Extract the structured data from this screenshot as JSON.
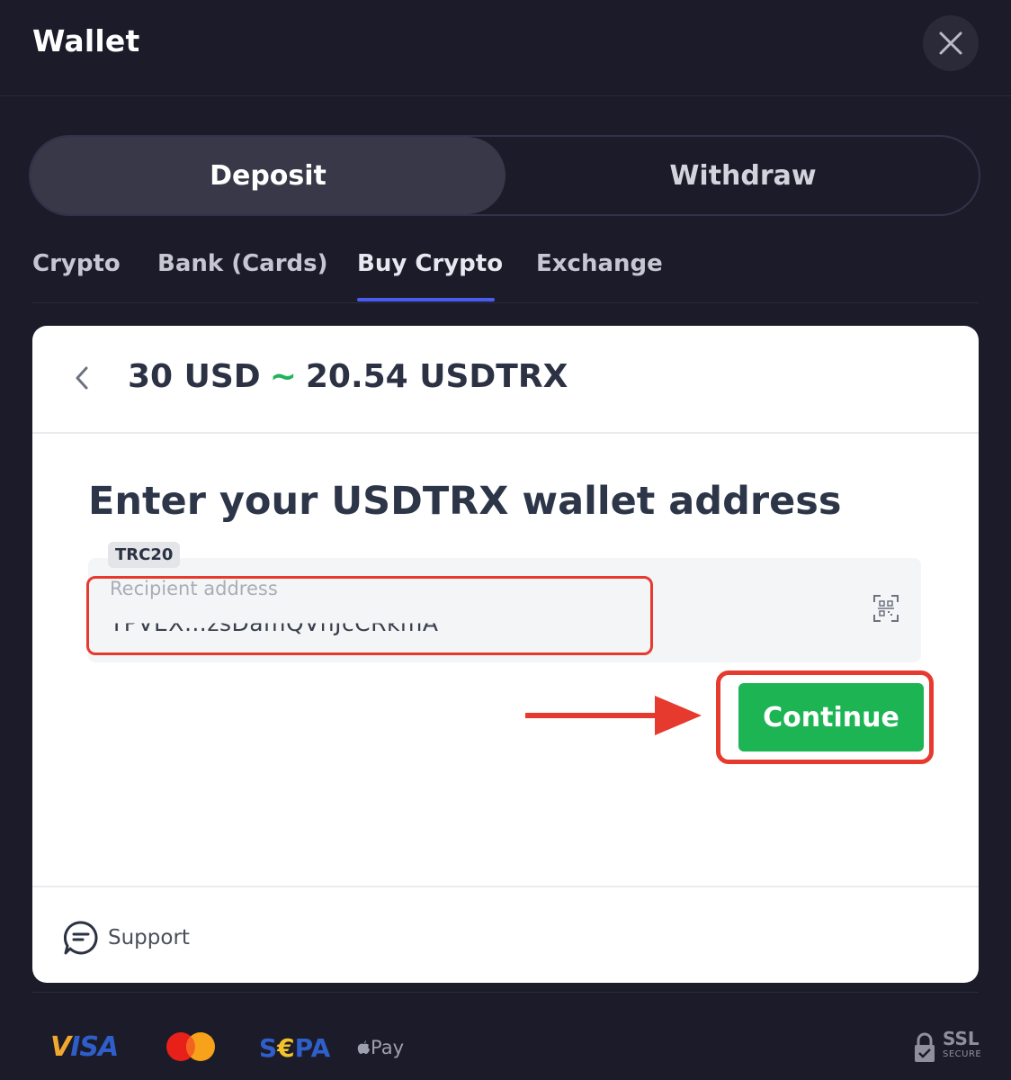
{
  "header": {
    "title": "Wallet"
  },
  "mode_toggle": {
    "deposit_label": "Deposit",
    "withdraw_label": "Withdraw",
    "selected": "Deposit"
  },
  "subtabs": {
    "items": [
      "Crypto",
      "Bank (Cards)",
      "Buy Crypto",
      "Exchange"
    ],
    "active": "Buy Crypto"
  },
  "quote": {
    "from": "30 USD",
    "separator": "~",
    "to": "20.54 USDTRX"
  },
  "form": {
    "heading": "Enter your USDTRX wallet address",
    "network_badge": "TRC20",
    "address_label": "Recipient address",
    "address_value": "TPVEX…zsDamQVhJcCRkmA"
  },
  "actions": {
    "continue_label": "Continue"
  },
  "support": {
    "label": "Support"
  },
  "payment_methods": {
    "visa": "VISA",
    "sepa": "SEPA",
    "apple_pay": "Pay",
    "ssl": "SSL",
    "ssl_sub": "SECURE"
  },
  "colors": {
    "background": "#1c1b29",
    "accent_green": "#1db454",
    "highlight_red": "#e73a2f",
    "tab_underline": "#4a5cf0"
  }
}
